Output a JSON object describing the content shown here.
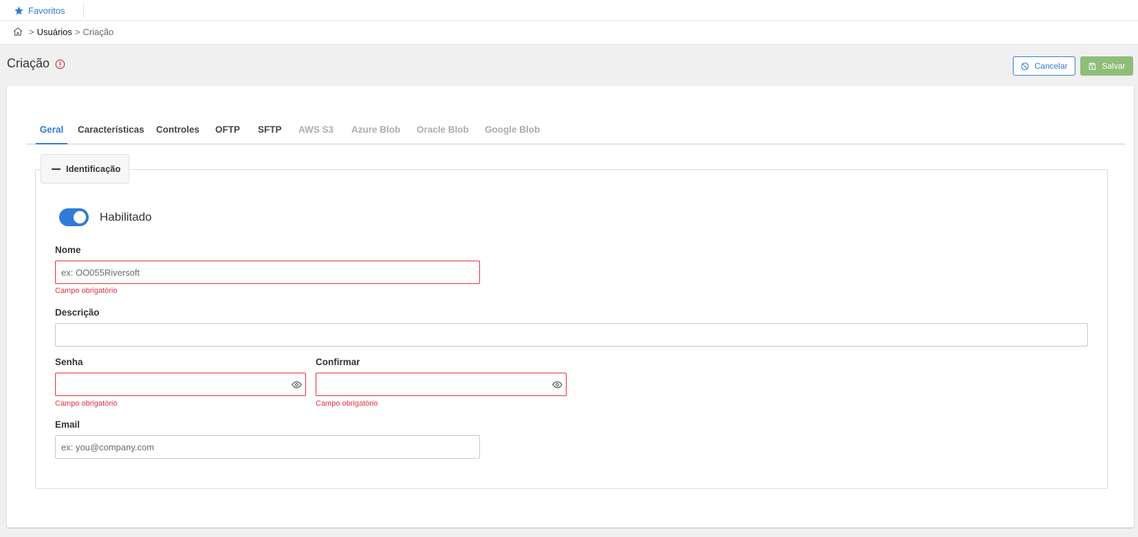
{
  "topbar": {
    "favorites_label": "Favoritos"
  },
  "breadcrumb": {
    "separator": ">",
    "users": "Usuários",
    "current": "Criação"
  },
  "header": {
    "title": "Criação",
    "cancel_label": "Cancelar",
    "save_label": "Salvar"
  },
  "tabs": [
    {
      "label": "Geral",
      "state": "active"
    },
    {
      "label": "Características",
      "state": "enabled"
    },
    {
      "label": "Controles",
      "state": "enabled"
    },
    {
      "label": "OFTP",
      "state": "enabled"
    },
    {
      "label": "SFTP",
      "state": "enabled"
    },
    {
      "label": "AWS S3",
      "state": "disabled"
    },
    {
      "label": "Azure Blob",
      "state": "disabled"
    },
    {
      "label": "Oracle Blob",
      "state": "disabled"
    },
    {
      "label": "Google Blob",
      "state": "disabled"
    }
  ],
  "section": {
    "title": "Identificação"
  },
  "form": {
    "enabled": {
      "label": "Habilitado",
      "value": true
    },
    "name": {
      "label": "Nome",
      "value": "",
      "placeholder": "ex: OO055Riversoft",
      "error": "Campo obrigatório"
    },
    "description": {
      "label": "Descrição",
      "value": "",
      "placeholder": ""
    },
    "password": {
      "label": "Senha",
      "value": "",
      "placeholder": "",
      "error": "Campo obrigatório"
    },
    "confirm": {
      "label": "Confirmar",
      "value": "",
      "placeholder": "",
      "error": "Campo obrigatório"
    },
    "email": {
      "label": "Email",
      "value": "",
      "placeholder": "ex: you@company.com"
    }
  },
  "colors": {
    "accent": "#2f7bd9",
    "error": "#e0313d",
    "save_button": "#8fbd7a",
    "disabled_tab": "#a8adb3"
  },
  "icons": {
    "favorites": "star-icon",
    "home": "home-icon",
    "warning": "alert-circle-icon",
    "cancel": "ban-icon",
    "save": "floppy-disk-icon",
    "section_toggle": "minus-icon",
    "password_reveal": "eye-icon"
  }
}
